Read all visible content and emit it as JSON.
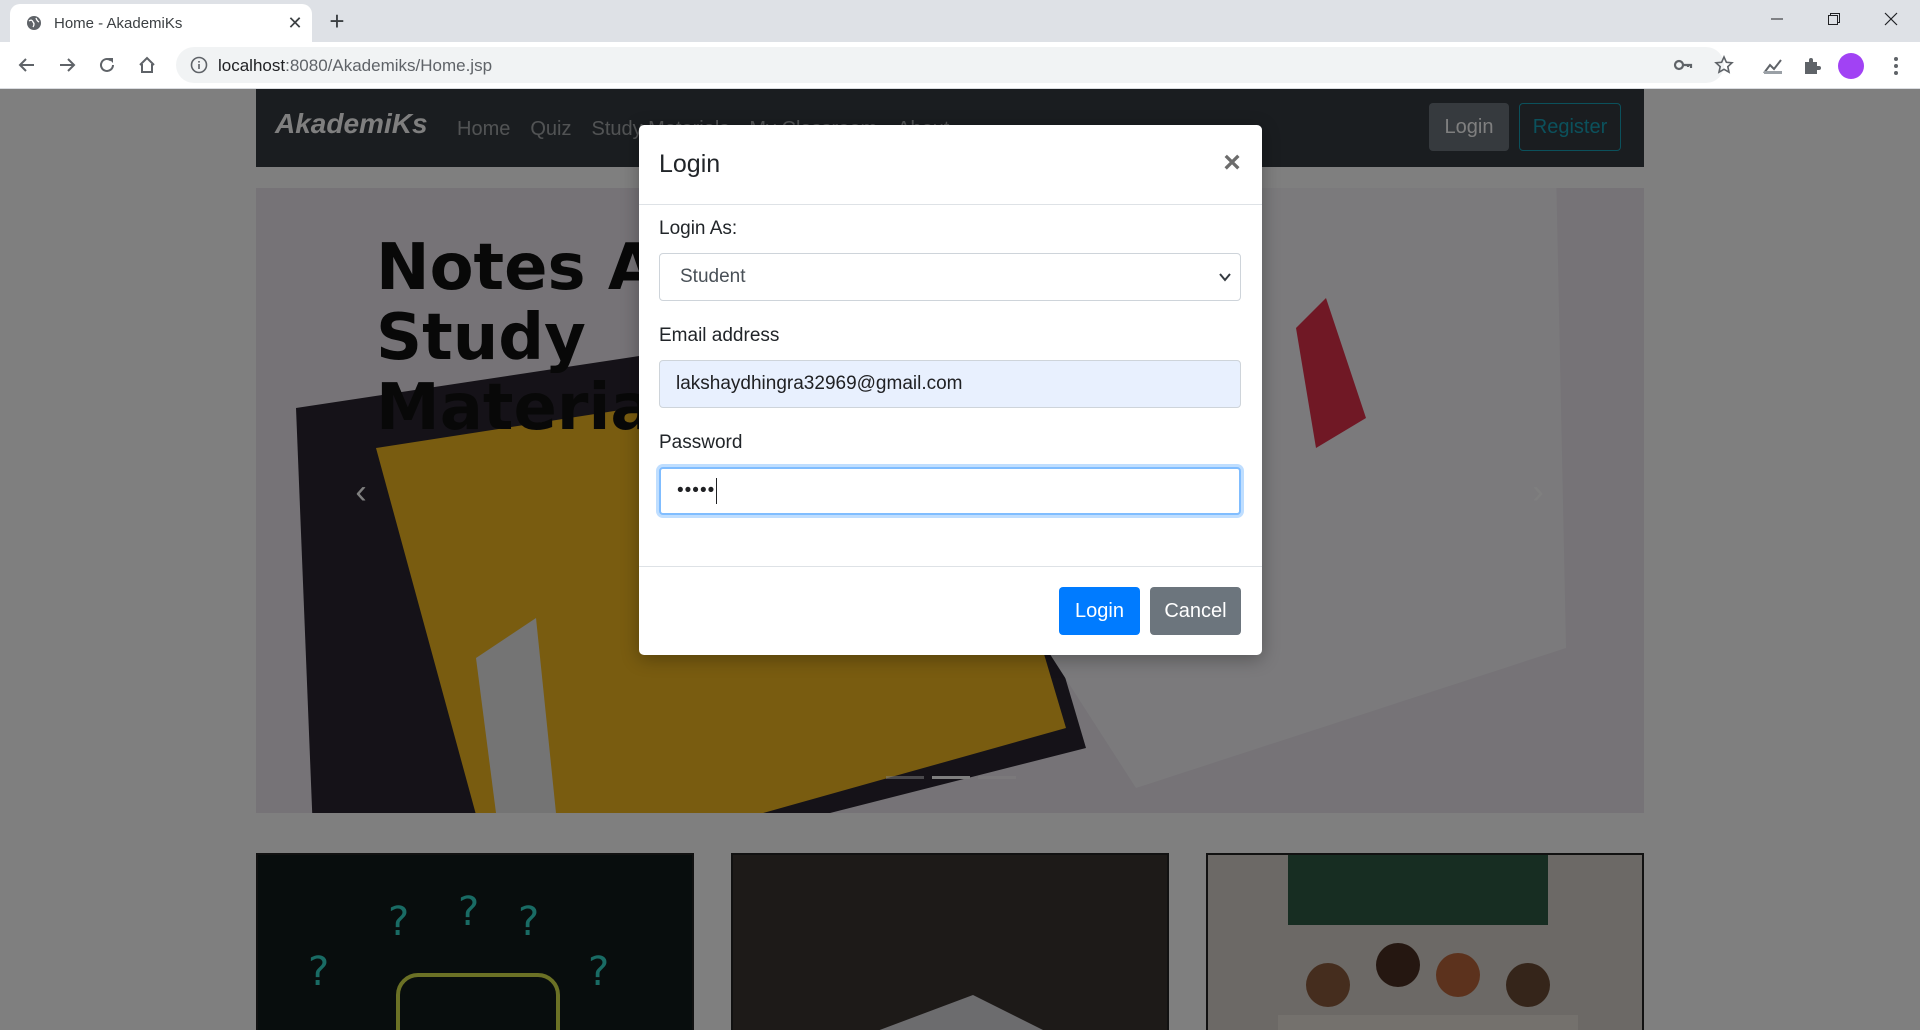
{
  "browser": {
    "tab_title": "Home - AkademiKs",
    "url_host": "localhost",
    "url_path": ":8080/Akademiks/Home.jsp"
  },
  "site": {
    "brand": "AkademiKs",
    "nav_links": [
      "Home",
      "Quiz",
      "Study Materials",
      "My Classroom",
      "About"
    ],
    "login_button": "Login",
    "register_button": "Register"
  },
  "carousel": {
    "slide_heading_lines": [
      "Notes And",
      "Study",
      "Materials"
    ],
    "indicator_count": 3,
    "active_index": 1
  },
  "modal": {
    "title": "Login",
    "close_glyph": "×",
    "login_as_label": "Login As:",
    "login_as_value": "Student",
    "email_label": "Email address",
    "email_value": "lakshaydhingra32969@gmail.com",
    "password_label": "Password",
    "password_masked": "•••••",
    "submit_label": "Login",
    "cancel_label": "Cancel"
  },
  "colors": {
    "primary": "#007bff",
    "secondary": "#6c757d",
    "navbar": "#343a40",
    "info": "#17a2b8",
    "autofill_bg": "#e8f0fe"
  },
  "icons": {
    "favicon": "globe-icon",
    "back": "arrow-left-icon",
    "forward": "arrow-right-icon",
    "reload": "reload-icon",
    "home": "home-icon",
    "info": "info-icon",
    "key": "key-icon",
    "bookmark": "star-icon",
    "extensions": "puzzle-icon"
  }
}
